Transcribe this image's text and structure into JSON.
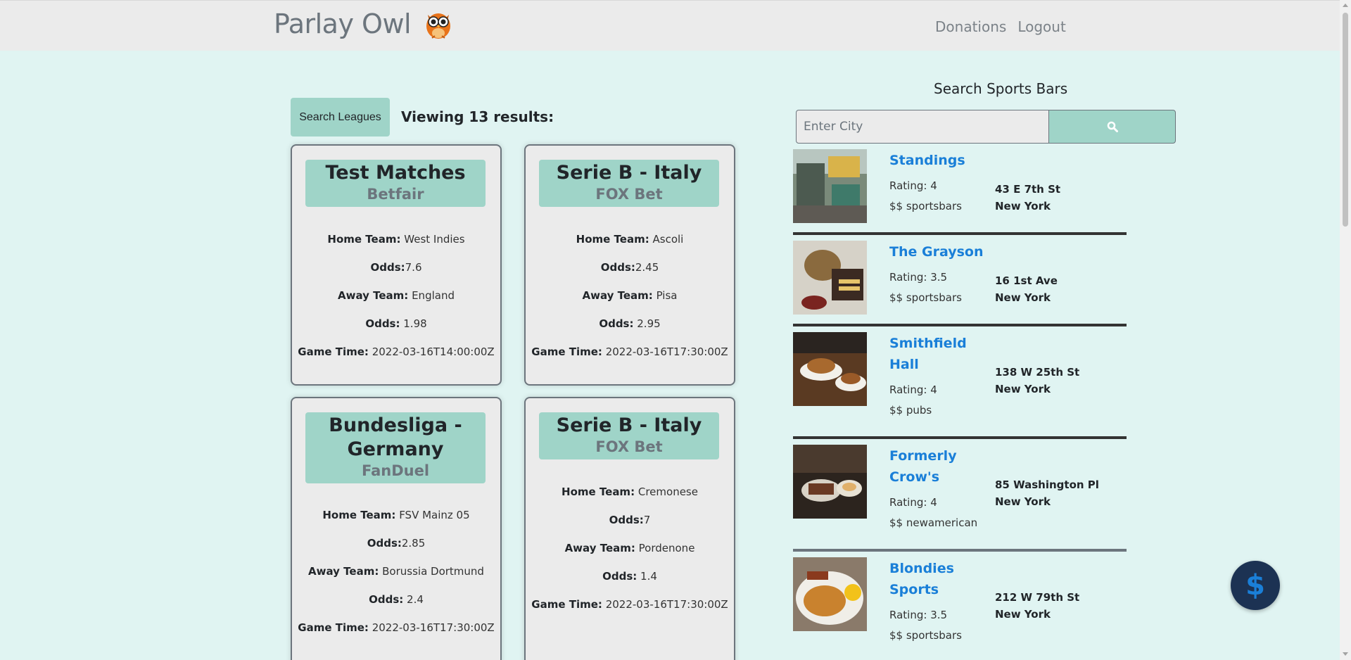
{
  "nav": {
    "brand": "Parlay Owl",
    "links": [
      "Donations",
      "Logout"
    ]
  },
  "leagues": {
    "search_button": "Search Leagues",
    "viewing": "Viewing 13 results:",
    "labels": {
      "home_team": "Home Team:",
      "odds_home": "Odds:",
      "away_team": "Away Team:",
      "odds_away": "Odds:",
      "game_time": "Game Time:"
    },
    "cards": [
      {
        "league": "Test Matches",
        "bookmaker": "Betfair",
        "home_team": "West Indies",
        "home_odds": "7.6",
        "away_team": "England",
        "away_odds": " 1.98",
        "game_time": "2022-03-16T14:00:00Z"
      },
      {
        "league": "Serie B - Italy",
        "bookmaker": "FOX Bet",
        "home_team": "Ascoli",
        "home_odds": "2.45",
        "away_team": "Pisa",
        "away_odds": " 2.95",
        "game_time": "2022-03-16T17:30:00Z"
      },
      {
        "league": "Bundesliga - Germany",
        "bookmaker": "FanDuel",
        "home_team": "FSV Mainz 05",
        "home_odds": "2.85",
        "away_team": "Borussia Dortmund",
        "away_odds": " 2.4",
        "game_time": "2022-03-16T17:30:00Z"
      },
      {
        "league": "Serie B - Italy",
        "bookmaker": "FOX Bet",
        "home_team": "Cremonese",
        "home_odds": "7",
        "away_team": "Pordenone",
        "away_odds": " 1.4",
        "game_time": "2022-03-16T17:30:00Z"
      }
    ]
  },
  "sports_bars": {
    "title": "Search Sports Bars",
    "search_placeholder": "Enter City",
    "search_icon": "search-icon",
    "rating_label": "Rating:",
    "bars": [
      {
        "name": "Standings",
        "rating": "4",
        "price_category": "$$ sportsbars",
        "street": "43 E 7th St",
        "city": "New York"
      },
      {
        "name": "The Grayson",
        "rating": "3.5",
        "price_category": "$$ sportsbars",
        "street": "16 1st Ave",
        "city": "New York"
      },
      {
        "name": "Smithfield Hall",
        "rating": "4",
        "price_category": "$$ pubs",
        "street": "138 W 25th St",
        "city": "New York"
      },
      {
        "name": "Formerly Crow's",
        "rating": "4",
        "price_category": "$$ newamerican",
        "street": "85 Washington Pl",
        "city": "New York"
      },
      {
        "name": "Blondies Sports",
        "rating": "3.5",
        "price_category": "$$ sportsbars",
        "street": "212 W 79th St",
        "city": "New York"
      }
    ]
  },
  "fab": {
    "symbol": "$",
    "icon": "dollar-icon"
  },
  "colors": {
    "background": "#e0f4f2",
    "navbar": "#ebebeb",
    "accent": "#9fd4c8",
    "link": "#1a7fd8",
    "fab": "#1c3253"
  }
}
